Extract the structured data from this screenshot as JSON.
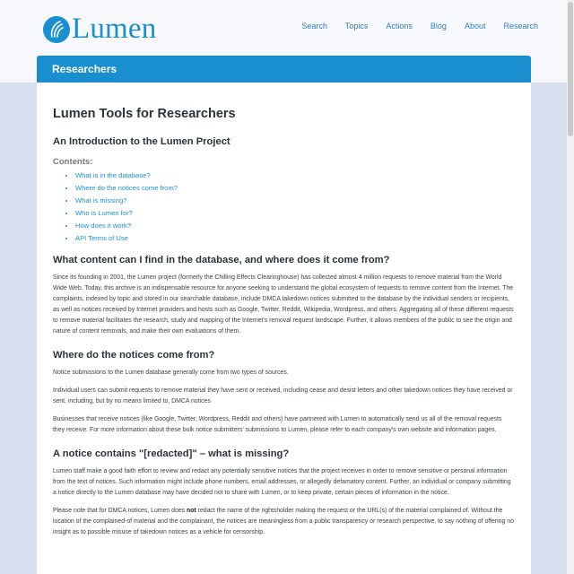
{
  "header": {
    "logo_text": "Lumen",
    "nav": [
      "Search",
      "Topics",
      "Actions",
      "Blog",
      "About",
      "Research"
    ]
  },
  "banner": {
    "title": "Researchers"
  },
  "page": {
    "title": "Lumen Tools for Researchers",
    "intro_heading": "An Introduction to the Lumen Project",
    "contents_label": "Contents:",
    "toc": [
      "What is in the database?",
      "Where do the notices come from?",
      "What is missing?",
      "Who is Lumen for?",
      "How does it work?",
      "API Terms of Use"
    ],
    "sections": [
      {
        "heading": "What content can I find in the database, and where does it come from?",
        "paragraphs": [
          "Since its founding in 2001, the Lumen project (formerly the Chilling Effects Clearinghouse) has collected almost 4 million requests to remove material from the World Wide Web. Today, this archive is an indispensable resource for anyone seeking to understand the global ecosystem of requests to remove content from the Internet. The complaints, indexed by topic and stored in our searchable database, include DMCA takedown notices submitted to the database by the individual senders or recipients, as well as notices received by Internet providers and hosts such as Google, Twitter, Reddit, Wikipedia, Wordpress, and others. Aggregating all of these different requests to remove material facilitates the research, study and mapping of the Internet's removal request landscape. Further, it allows members of the public to see the origin and nature of content removals, and make their own evaluations of them."
        ]
      },
      {
        "heading": "Where do the notices come from?",
        "paragraphs": [
          "Notice submissions to the Lumen database generally come from two types of sources.",
          "Individual users can submit requests to remove material they have sent or received, including cease and desist letters and other takedown notices they have received or sent, including, but by no means limited to, DMCA notices",
          "Businesses that receive notices (like Google, Twitter, Wordpress, Reddit and others) have partnered with Lumen to automatically send us all of the removal requests they receive. For more information about these bulk notice submitters' submissions to Lumen, please refer to each company's own website and information pages."
        ]
      },
      {
        "heading": "A notice contains \"[redacted]\" – what is missing?",
        "paragraphs": [
          "Lumen staff make a good faith effort to review and redact any potentially sensitive notices that the project receives in order to remove sensitive or personal information from the text of notices. Such information might include phone numbers, email addresses, or allegedly defamatory content. Further, an individual or company submitting a notice directly to the Lumen database may have decided not to share with Lumen, or to keep private, certain pieces of information in the notice."
        ],
        "note_before": "Please note that for DMCA notices, Lumen does ",
        "note_bold": "not",
        "note_after": " redact the name of the rightsholder making the request or the URL(s) of the material complained of. Without the location of the complained-of material and the complainant, the notices are meaningless from a public transparency or research perspective, to say nothing of offering no insight as to possible misuse of takedown notices as a vehicle for censorship."
      }
    ]
  }
}
